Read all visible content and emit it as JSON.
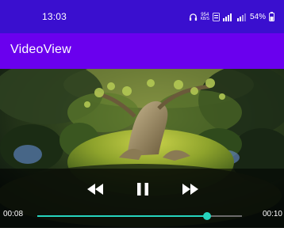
{
  "status_bar": {
    "time": "13:03",
    "net_speed": "954",
    "net_unit": "KB/S",
    "battery": "54%"
  },
  "app_bar": {
    "title": "VideoView"
  },
  "player": {
    "current_time": "00:08",
    "total_time": "00:10",
    "progress_fraction": 0.83,
    "accent_color": "#26d5be",
    "state": "playing",
    "controls": {
      "rewind_icon": "rewind-icon",
      "pause_icon": "pause-icon",
      "fast_forward_icon": "fast-forward-icon"
    }
  },
  "colors": {
    "status_bar": "#3a0fcf",
    "app_bar": "#6a00ee"
  }
}
